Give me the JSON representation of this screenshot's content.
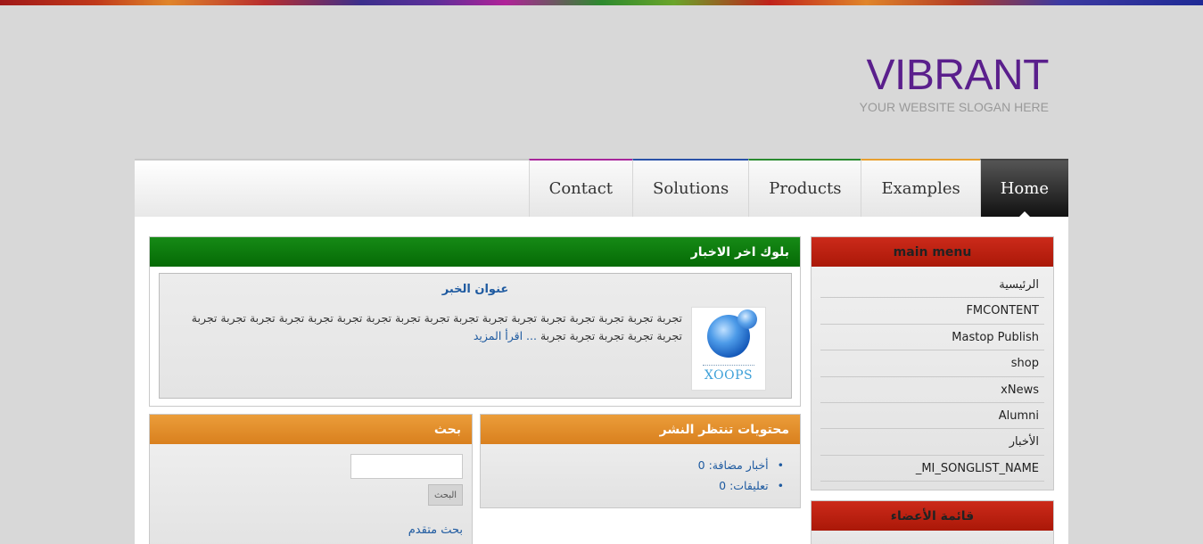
{
  "header": {
    "site_name": "VIBRANT",
    "slogan": "YOUR WEBSITE SLOGAN HERE"
  },
  "nav": {
    "items": [
      "Contact",
      "Solutions",
      "Products",
      "Examples",
      "Home"
    ],
    "active": "Home"
  },
  "main_menu": {
    "title": "main menu",
    "items": [
      "الرئيسية",
      "FMCONTENT",
      "Mastop Publish",
      "shop",
      "xNews",
      "Alumni",
      "الأخبار",
      "MI_SONGLIST_NAME_"
    ]
  },
  "members_block": {
    "title": "قائمة الأعضاء"
  },
  "news_block": {
    "title": "بلوك اخر الاخبار",
    "item_title": "عنوان الخبر",
    "image_label": "XOOPS",
    "body": "تجربة تجربة تجربة تجربة تجربة تجربة تجربة تجربة تجربة تجربة تجربة تجربة تجربة تجربة تجربة تجربة تجربة تجربة تجربة تجربة تجربة تجربة",
    "read_more": "... اقرأ المزيد"
  },
  "waiting_block": {
    "title": "محتويات تنتظر النشر",
    "items": [
      "أخبار مضافة: 0",
      "تعليقات: 0"
    ]
  },
  "search_block": {
    "title": "بحث",
    "button": "البحث",
    "advanced": "بحث متقدم"
  },
  "colors": {
    "brand": "#5a1f8c",
    "menu_header": "#cc2a1a",
    "news_header": "#168a16",
    "block_header": "#eb9d3a",
    "link": "#1e5aa0"
  }
}
